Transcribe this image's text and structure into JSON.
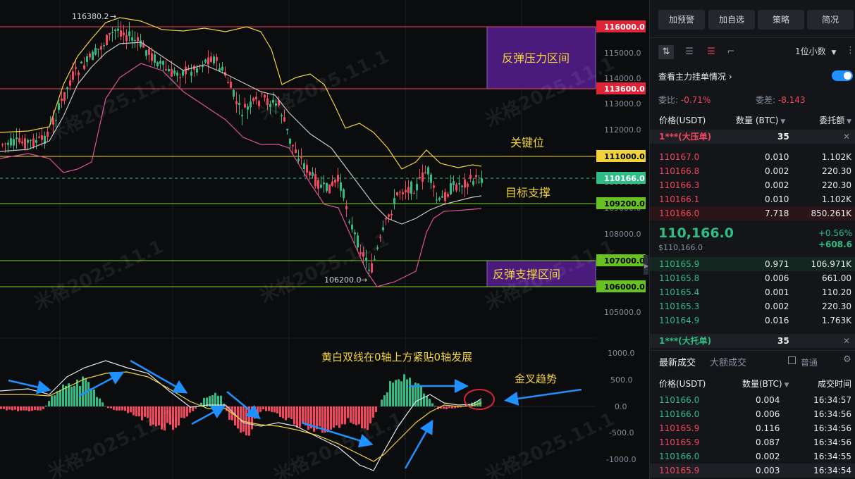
{
  "chart": {
    "price_axis_ticks": [
      "115000.0",
      "114000.0",
      "113000.0",
      "112000.0",
      "110000.0",
      "109000.0",
      "108000.0",
      "105000.0"
    ],
    "macd_axis_ticks": [
      "1000.0",
      "500.0",
      "0.0",
      "-500.0",
      "-1000.0"
    ],
    "level_labels": {
      "l116000": "116000.0",
      "l113600": "113600.0",
      "l111000": "111000.0",
      "l110166": "110166.0",
      "l109200": "109200.0",
      "l107000": "107000.0",
      "l106000": "106000.0"
    },
    "high_marker": "116380.2",
    "low_marker": "106200.0",
    "annotations": {
      "resistance_zone": "反弹压力区间",
      "key_level": "关键位",
      "target_support": "目标支撑",
      "support_zone": "反弹支撑区间",
      "macd_note": "黄白双线在0轴上方紧贴0轴发展",
      "golden_cross": "金叉趋势"
    },
    "watermark": "米格2025.11.1",
    "colors": {
      "up": "#2ebd85",
      "down": "#f6465d",
      "yellow_line": "#f0d43a",
      "white_line": "#c8c8c8",
      "pink_line": "#e0529c",
      "resistance_zone_fill": "#5a1d8f",
      "support_zone_fill": "#5a1d8f",
      "arrow": "#1e90ff"
    }
  },
  "toolbar": {
    "alert": "加预警",
    "watchlist": "加自选",
    "strategy": "策略",
    "simple": "简况"
  },
  "orderbook": {
    "decimal_select": "1位小数",
    "main_orders_label": "查看主力挂单情况",
    "ratio_label": "委比:",
    "ratio_value": "-0.71%",
    "diff_label": "委差:",
    "diff_value": "-8.143",
    "col_price": "价格(USDT)",
    "col_amount": "数量 (BTC)",
    "col_total": "委托额",
    "sell_banner_name": "1***(大压单)",
    "sell_banner_amount": "35",
    "asks": [
      {
        "price": "110167.0",
        "amount": "0.010",
        "total": "1.102K"
      },
      {
        "price": "110166.8",
        "amount": "0.002",
        "total": "220.30"
      },
      {
        "price": "110166.3",
        "amount": "0.002",
        "total": "220.30"
      },
      {
        "price": "110166.1",
        "amount": "0.010",
        "total": "1.102K"
      },
      {
        "price": "110166.0",
        "amount": "7.718",
        "total": "850.261K"
      }
    ],
    "last_price": "110,166.0",
    "last_price_usd": "$110,166.0",
    "change_pct": "+0.56%",
    "change_abs": "+608.6",
    "bids": [
      {
        "price": "110165.9",
        "amount": "0.971",
        "total": "106.971K"
      },
      {
        "price": "110165.8",
        "amount": "0.006",
        "total": "661.00"
      },
      {
        "price": "110165.4",
        "amount": "0.001",
        "total": "110.20"
      },
      {
        "price": "110165.3",
        "amount": "0.002",
        "total": "220.30"
      },
      {
        "price": "110164.9",
        "amount": "0.016",
        "total": "1.763K"
      }
    ],
    "buy_banner_name": "1***(大托单)",
    "buy_banner_amount": "35"
  },
  "trades": {
    "tab_latest": "最新成交",
    "tab_large": "大额成交",
    "normal_label": "普通",
    "col_price": "价格(USDT)",
    "col_amount": "数量(BTC)",
    "col_time": "成交时间",
    "rows": [
      {
        "price": "110166.0",
        "amount": "0.004",
        "time": "16:34:57",
        "side": "buy"
      },
      {
        "price": "110166.0",
        "amount": "0.006",
        "time": "16:34:56",
        "side": "buy"
      },
      {
        "price": "110165.9",
        "amount": "0.116",
        "time": "16:34:56",
        "side": "sell"
      },
      {
        "price": "110165.9",
        "amount": "0.087",
        "time": "16:34:56",
        "side": "sell"
      },
      {
        "price": "110166.0",
        "amount": "0.002",
        "time": "16:34:55",
        "side": "buy"
      },
      {
        "price": "110165.9",
        "amount": "0.003",
        "time": "16:34:54",
        "side": "sell"
      }
    ]
  }
}
